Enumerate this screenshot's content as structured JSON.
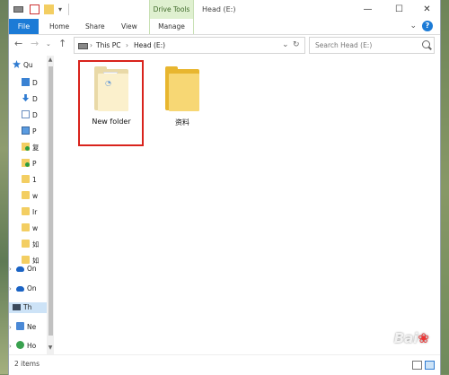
{
  "window": {
    "title": "Head (E:)",
    "context_tab": "Drive Tools",
    "controls": [
      "—",
      "☐",
      "✕"
    ]
  },
  "ribbon": {
    "tabs": [
      "File",
      "Home",
      "Share",
      "View",
      "Manage"
    ],
    "accent": "#1c7bd6"
  },
  "address": {
    "crumbs": [
      "This PC",
      "Head (E:)"
    ],
    "search_placeholder": "Search Head (E:)"
  },
  "nav": {
    "items": [
      {
        "label": "Qu",
        "icon": "star-icon"
      },
      {
        "label": "D",
        "icon": "desktop-icon"
      },
      {
        "label": "D",
        "icon": "download-icon"
      },
      {
        "label": "D",
        "icon": "document-icon"
      },
      {
        "label": "P",
        "icon": "picture-icon"
      },
      {
        "label": "复",
        "icon": "folder-sync-icon"
      },
      {
        "label": "P",
        "icon": "folder-sync-icon"
      },
      {
        "label": "1",
        "icon": "folder-icon"
      },
      {
        "label": "w",
        "icon": "folder-icon"
      },
      {
        "label": "Ir",
        "icon": "folder-icon"
      },
      {
        "label": "w",
        "icon": "folder-icon"
      },
      {
        "label": "如",
        "icon": "folder-icon"
      },
      {
        "label": "如",
        "icon": "folder-icon"
      },
      {
        "label": "On",
        "icon": "onedrive-icon"
      },
      {
        "label": "On",
        "icon": "onedrive-icon"
      },
      {
        "label": "Th",
        "icon": "this-pc-icon"
      },
      {
        "label": "Ne",
        "icon": "network-icon"
      },
      {
        "label": "Ho",
        "icon": "homegroup-icon"
      }
    ]
  },
  "content": {
    "items": [
      {
        "label": "New folder",
        "icon": "new-folder-icon",
        "highlighted": true
      },
      {
        "label": "资料",
        "icon": "folder-icon",
        "highlighted": false
      }
    ]
  },
  "status": {
    "count": "2 items"
  },
  "watermark": "Bai"
}
